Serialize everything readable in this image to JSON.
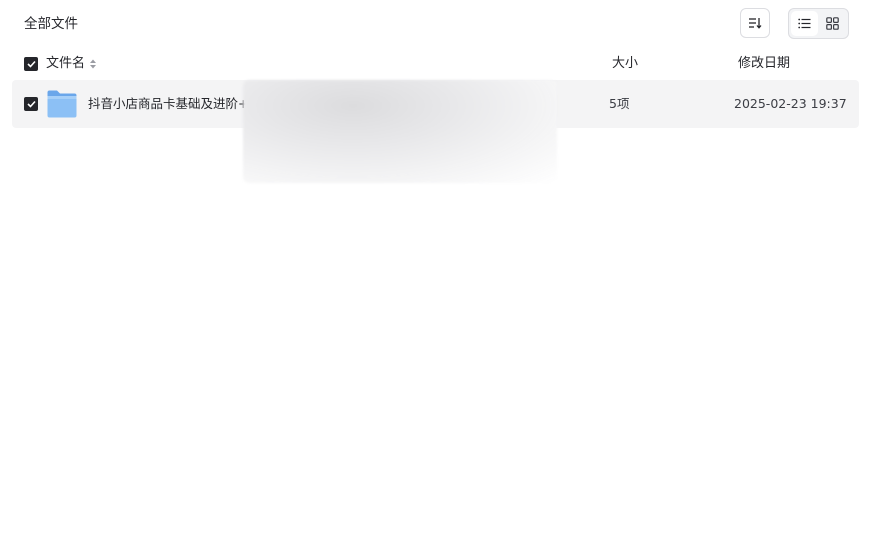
{
  "header": {
    "breadcrumb": "全部文件"
  },
  "toolbar": {
    "sort_icon": "sort-descending-icon",
    "view_list_icon": "list-view-icon",
    "view_grid_icon": "grid-view-icon",
    "active_view": "list"
  },
  "table": {
    "columns": {
      "name": "文件名",
      "size": "大小",
      "modified": "修改日期"
    },
    "select_all_checked": true,
    "sort_icon": "sort-caret-icon",
    "rows": [
      {
        "checked": true,
        "icon": "folder-icon",
        "name": "抖音小店商品卡基础及进阶+:",
        "size": "5项",
        "modified": "2025-02-23 19:37"
      }
    ]
  },
  "colors": {
    "row_selected_bg": "#f4f4f5",
    "checkbox_fill": "#25262b",
    "folder_blue": "#7fb6f2"
  }
}
